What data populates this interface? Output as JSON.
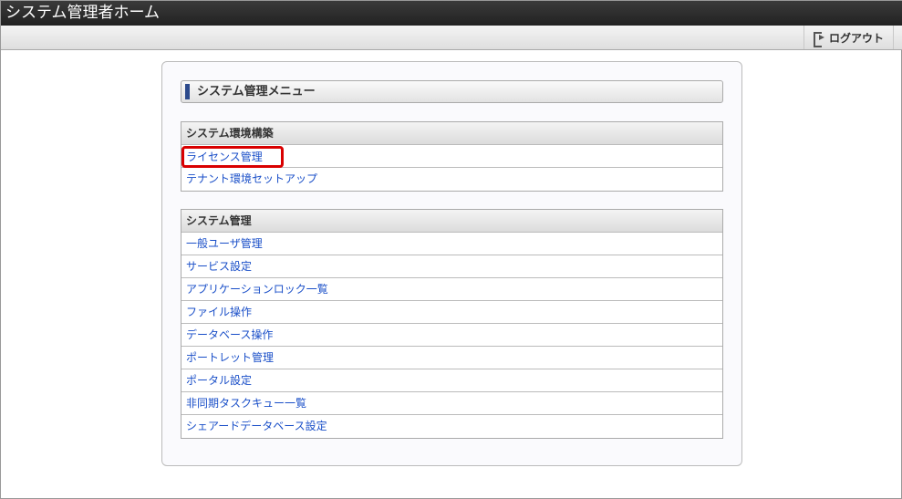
{
  "header": {
    "title": "システム管理者ホーム"
  },
  "toolbar": {
    "logout_label": "ログアウト"
  },
  "menu": {
    "title": "システム管理メニュー",
    "sections": [
      {
        "title": "システム環境構築",
        "items": [
          "ライセンス管理",
          "テナント環境セットアップ"
        ]
      },
      {
        "title": "システム管理",
        "items": [
          "一般ユーザ管理",
          "サービス設定",
          "アプリケーションロック一覧",
          "ファイル操作",
          "データベース操作",
          "ポートレット管理",
          "ポータル設定",
          "非同期タスクキュー一覧",
          "シェアードデータベース設定"
        ]
      }
    ]
  },
  "highlight_color": "#d90000"
}
